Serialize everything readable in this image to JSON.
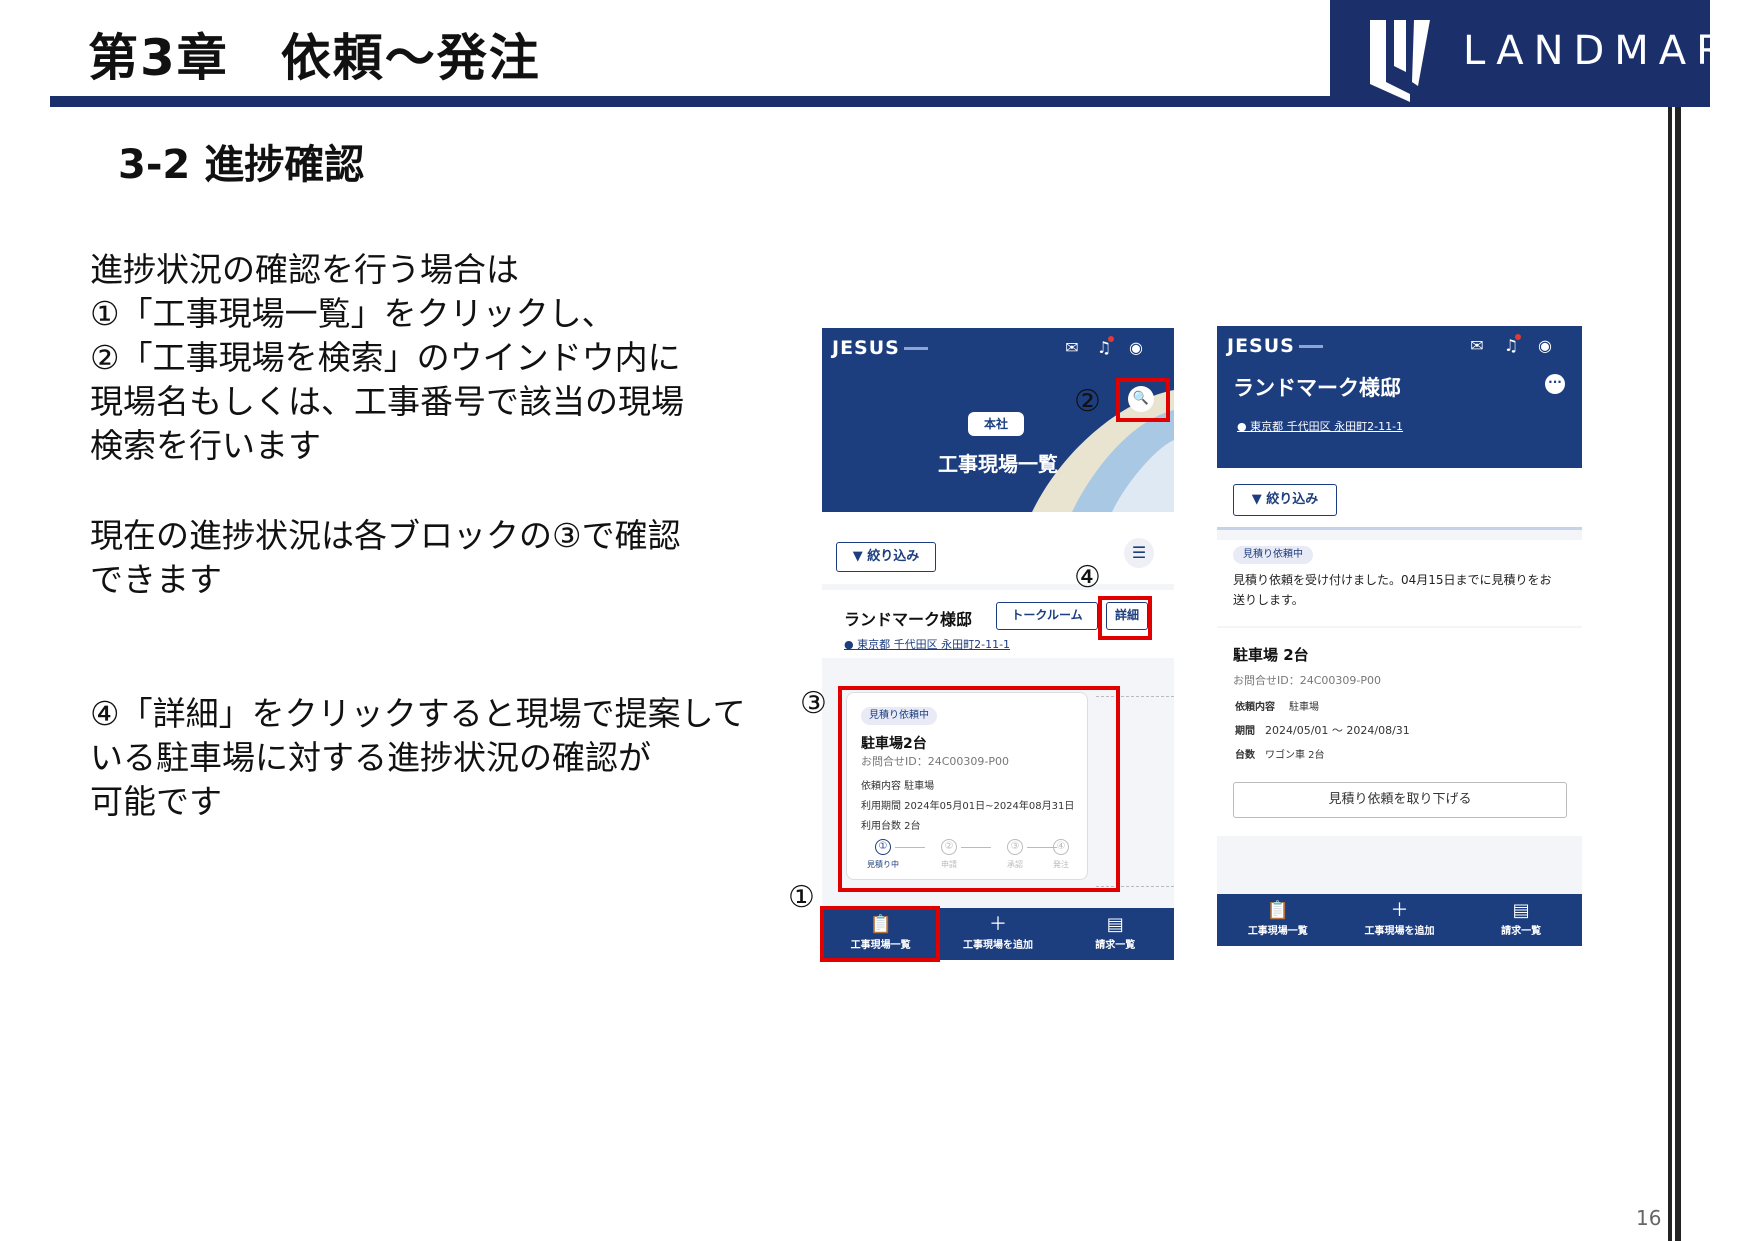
{
  "header": {
    "chapter_title": "第3章　依頼～発注",
    "logo_text": "LANDMARK"
  },
  "section_title": "3-2 進捗確認",
  "paragraphs": {
    "p1": "進捗状況の確認を行う場合は\n①「工事現場一覧」をクリックし、\n②「工事現場を検索」のウインドウ内に\n現場名もしくは、工事番号で該当の現場\n検索を行います",
    "p2": "現在の進捗状況は各ブロックの③で確認\nできます",
    "p3": "④「詳細」をクリックすると現場で提案して\nいる駐車場に対する進捗状況の確認が\n可能です"
  },
  "page_number": "16",
  "annotations": {
    "a1": "①",
    "a2": "②",
    "a3": "③",
    "a4": "④"
  },
  "screen1": {
    "brand": "JESUS",
    "topbar_icons": [
      "mail-icon",
      "bell-icon",
      "account-icon"
    ],
    "badge": "本社",
    "hero_title": "工事現場一覧",
    "filter_label": "▼ 絞り込み",
    "site_name": "ランドマーク様邸",
    "site_address": "東京都 千代田区 永田町2-11-1",
    "talk_room_label": "トークルーム",
    "detail_label": "詳細",
    "card": {
      "status": "見積り依頼中",
      "title": "駐車場2台",
      "inquiry_id": "お問合せID：24C00309-P00",
      "request_content": "依頼内容 駐車場",
      "period": "利用期間 2024年05月01日~2024年08月31日",
      "count": "利用台数 2台",
      "steps": [
        {
          "num": "①",
          "label": "見積り中"
        },
        {
          "num": "②",
          "label": "申請"
        },
        {
          "num": "③",
          "label": "承認"
        },
        {
          "num": "④",
          "label": "発注"
        }
      ]
    },
    "nav": [
      {
        "icon": "📋",
        "label": "工事現場一覧"
      },
      {
        "icon": "＋",
        "label": "工事現場を追加"
      },
      {
        "icon": "▤",
        "label": "請求一覧"
      }
    ]
  },
  "screen2": {
    "brand": "JESUS",
    "site_name": "ランドマーク様邸",
    "site_address": "東京都 千代田区 永田町2-11-1",
    "more_icon": "···",
    "filter_label": "▼ 絞り込み",
    "status": "見積り依頼中",
    "message": "見積り依頼を受け付けました。04月15日までに見積りをお送りします。",
    "detail_title": "駐車場 2台",
    "inquiry_id": "お問合せID：24C00309-P00",
    "request_label": "依頼内容",
    "request_value": "駐車場",
    "period_label": "期間",
    "period_value": "2024/05/01 ～ 2024/08/31",
    "count_label": "台数",
    "count_value": "ワゴン車 2台",
    "cancel_label": "見積り依頼を取り下げる",
    "nav": [
      {
        "icon": "📋",
        "label": "工事現場一覧"
      },
      {
        "icon": "＋",
        "label": "工事現場を追加"
      },
      {
        "icon": "▤",
        "label": "請求一覧"
      }
    ]
  }
}
